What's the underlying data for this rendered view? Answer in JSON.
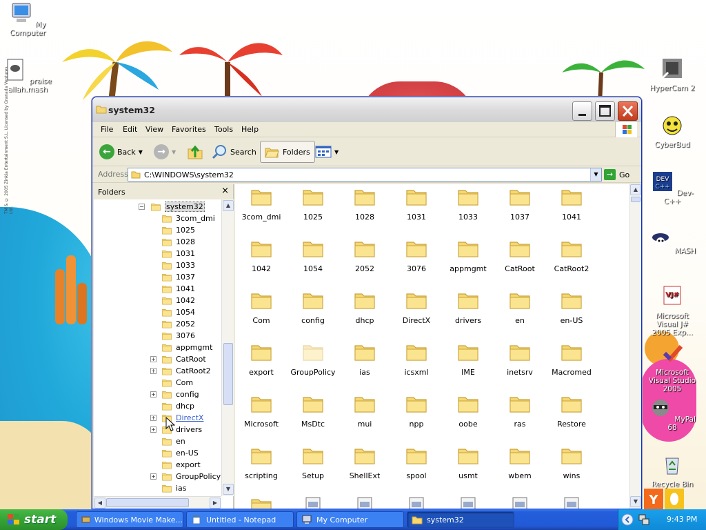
{
  "desktop": {
    "icons": [
      {
        "id": "my-computer",
        "label": "My Computer"
      },
      {
        "id": "praise-allah",
        "label": "praise\nallah.mash"
      },
      {
        "id": "hypercam",
        "label": "HyperCam 2"
      },
      {
        "id": "cyberbud",
        "label": "CyberBud"
      },
      {
        "id": "devcpp",
        "label": "Dev-C++"
      },
      {
        "id": "mash",
        "label": "MASH"
      },
      {
        "id": "vjsharp",
        "label": "Microsoft Visual J# 2005 Exp..."
      },
      {
        "id": "vstudio",
        "label": "Microsoft Visual Studio 2005"
      },
      {
        "id": "mypal",
        "label": "MyPal 68"
      },
      {
        "id": "recycle",
        "label": "Recycle Bin"
      }
    ],
    "copyright": "TM & © 2005 Zinkia Entertainment S.L. Licensed by Granada Ventures Ltd."
  },
  "window": {
    "title": "system32",
    "menu": [
      "File",
      "Edit",
      "View",
      "Favorites",
      "Tools",
      "Help"
    ],
    "toolbar": {
      "back": "Back",
      "search": "Search",
      "folders": "Folders"
    },
    "address": {
      "label": "Address",
      "value": "C:\\WINDOWS\\system32",
      "go": "Go"
    },
    "folder_pane": {
      "title": "Folders",
      "nodes": [
        {
          "label": "system32",
          "expander": "minus",
          "selected": true,
          "level": 0
        },
        {
          "label": "3com_dmi",
          "expander": "",
          "level": 1
        },
        {
          "label": "1025",
          "expander": "",
          "level": 1
        },
        {
          "label": "1028",
          "expander": "",
          "level": 1
        },
        {
          "label": "1031",
          "expander": "",
          "level": 1
        },
        {
          "label": "1033",
          "expander": "",
          "level": 1
        },
        {
          "label": "1037",
          "expander": "",
          "level": 1
        },
        {
          "label": "1041",
          "expander": "",
          "level": 1
        },
        {
          "label": "1042",
          "expander": "",
          "level": 1
        },
        {
          "label": "1054",
          "expander": "",
          "level": 1
        },
        {
          "label": "2052",
          "expander": "",
          "level": 1
        },
        {
          "label": "3076",
          "expander": "",
          "level": 1
        },
        {
          "label": "appmgmt",
          "expander": "",
          "level": 1
        },
        {
          "label": "CatRoot",
          "expander": "plus",
          "level": 1
        },
        {
          "label": "CatRoot2",
          "expander": "plus",
          "level": 1
        },
        {
          "label": "Com",
          "expander": "",
          "level": 1
        },
        {
          "label": "config",
          "expander": "plus",
          "level": 1
        },
        {
          "label": "dhcp",
          "expander": "",
          "level": 1
        },
        {
          "label": "DirectX",
          "expander": "plus",
          "level": 1,
          "hover": true
        },
        {
          "label": "drivers",
          "expander": "plus",
          "level": 1
        },
        {
          "label": "en",
          "expander": "",
          "level": 1
        },
        {
          "label": "en-US",
          "expander": "",
          "level": 1
        },
        {
          "label": "export",
          "expander": "",
          "level": 1
        },
        {
          "label": "GroupPolicy",
          "expander": "plus",
          "level": 1
        },
        {
          "label": "ias",
          "expander": "",
          "level": 1
        }
      ]
    },
    "items": [
      [
        "3com_dmi",
        "1025",
        "1028",
        "1031",
        "1033",
        "1037",
        "1041"
      ],
      [
        "1042",
        "1054",
        "2052",
        "3076",
        "appmgmt",
        "CatRoot",
        "CatRoot2"
      ],
      [
        "Com",
        "config",
        "dhcp",
        "DirectX",
        "drivers",
        "en",
        "en-US"
      ],
      [
        "export",
        "GroupPolicy",
        "ias",
        "icsxml",
        "IME",
        "inetsrv",
        "Macromed"
      ],
      [
        "Microsoft",
        "MsDtc",
        "mui",
        "npp",
        "oobe",
        "ras",
        "Restore"
      ],
      [
        "scripting",
        "Setup",
        "ShellExt",
        "spool",
        "usmt",
        "wbem",
        "wins"
      ]
    ]
  },
  "taskbar": {
    "start": "start",
    "tasks": [
      {
        "label": "Windows Movie Make...",
        "active": false
      },
      {
        "label": "Untitled - Notepad",
        "active": false
      },
      {
        "label": "My Computer",
        "active": false
      },
      {
        "label": "system32",
        "active": true
      }
    ],
    "clock": "9:43 PM"
  },
  "colors": {
    "folder": "#f5d774",
    "folder_edge": "#c9a23a",
    "titlebar": "#dcdcdc",
    "taskbar": "#245edb",
    "start": "#35a335"
  }
}
